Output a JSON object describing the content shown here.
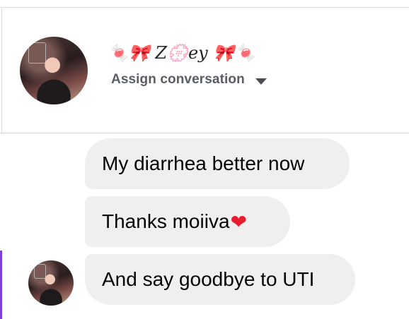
{
  "conversation": {
    "contact_name": "🍬🎀 Z💮ey 🎀🍬",
    "assign_label": "Assign conversation"
  },
  "messages": [
    {
      "text": "My diarrhea better now"
    },
    {
      "text": "Thanks moiiva",
      "emoji": "❤"
    },
    {
      "text": "And say goodbye to UTI"
    }
  ],
  "colors": {
    "bubble_bg": "#efefef",
    "accent": "#7b3fe4",
    "heart": "#e81d2c",
    "muted_text": "#5a5d63"
  }
}
